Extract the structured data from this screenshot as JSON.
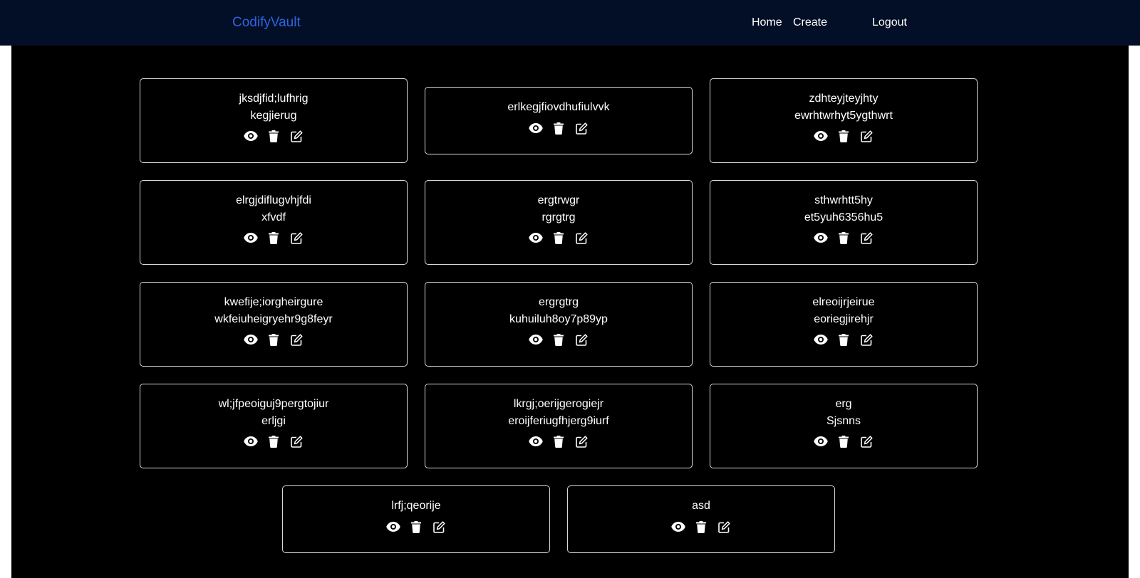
{
  "app": {
    "brand": "CodifyVault"
  },
  "nav": {
    "home": "Home",
    "create": "Create",
    "logout": "Logout"
  },
  "icons": {
    "view": "eye-icon",
    "delete": "trash-icon",
    "edit": "edit-icon"
  },
  "colors": {
    "navbar_bg": "#020f26",
    "brand": "#2f63e0",
    "content_bg": "#000000",
    "card_border": "#d9d9d9",
    "text": "#ffffff"
  },
  "snippets": [
    {
      "title": "jksdjfid;lufhrig",
      "description": "kegjierug"
    },
    {
      "title": "erlkegjfiovdhufiulvvk",
      "description": ""
    },
    {
      "title": "zdhteyjteyjhty",
      "description": "ewrhtwrhyt5ygthwrt"
    },
    {
      "title": "elrgjdiflugvhjfdi",
      "description": "xfvdf"
    },
    {
      "title": "ergtrwgr",
      "description": "rgrgtrg"
    },
    {
      "title": "sthwrhtt5hy",
      "description": "et5yuh6356hu5"
    },
    {
      "title": "kwefije;iorgheirgure",
      "description": "wkfeiuheigryehr9g8feyr"
    },
    {
      "title": "ergrgtrg",
      "description": "kuhuiluh8oy7p89yp"
    },
    {
      "title": "elreoijrjeirue",
      "description": "eoriegjirehjr"
    },
    {
      "title": "wl;jfpeoiguj9pergtojiur",
      "description": "erljgi"
    },
    {
      "title": "lkrgj;oerijgerogiejr",
      "description": "eroijferiugfhjerg9iurf"
    },
    {
      "title": "erg",
      "description": "Sjsnns"
    },
    {
      "title": "lrfj;qeorije",
      "description": ""
    },
    {
      "title": "asd",
      "description": ""
    }
  ]
}
